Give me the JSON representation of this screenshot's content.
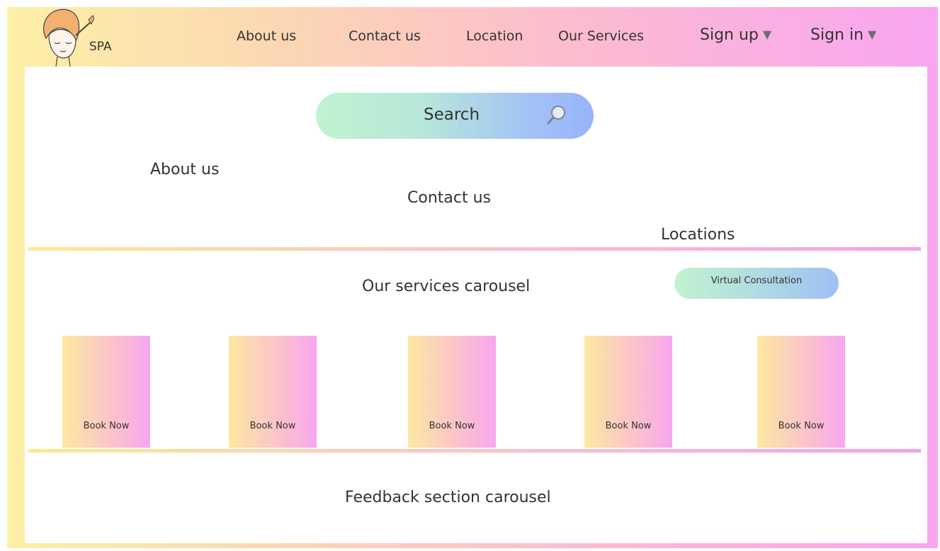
{
  "brand": {
    "logo_text": "SPA"
  },
  "nav": {
    "about": "About us",
    "contact": "Contact us",
    "location": "Location",
    "services": "Our Services",
    "signup": "Sign up",
    "signin": "Sign in",
    "caret": "▼"
  },
  "search": {
    "placeholder": "Search"
  },
  "sections": {
    "about": "About us",
    "contact": "Contact us",
    "locations": "Locations",
    "services_carousel": "Our services carousel",
    "virtual_consultation": "Virtual Consultation",
    "feedback_carousel": "Feedback section carousel"
  },
  "cards": [
    {
      "button": "Book Now"
    },
    {
      "button": "Book Now"
    },
    {
      "button": "Book Now"
    },
    {
      "button": "Book Now"
    },
    {
      "button": "Book Now"
    }
  ],
  "colors": {
    "gradient_yellow": "#fdf0a6",
    "gradient_pink": "#f9a5f2",
    "search_green": "#c0f3cf",
    "search_blue": "#97b4fb"
  }
}
